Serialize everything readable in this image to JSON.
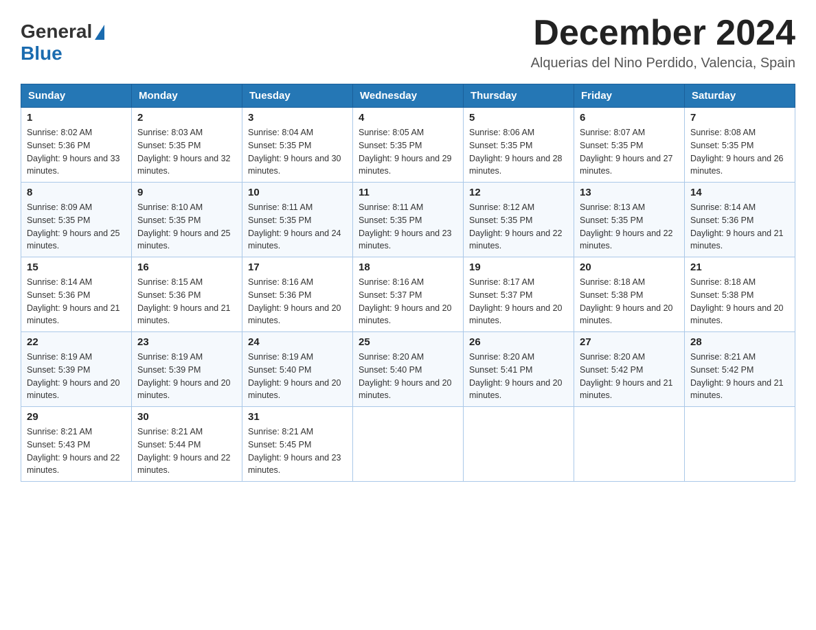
{
  "header": {
    "logo_general": "General",
    "logo_blue": "Blue",
    "month_title": "December 2024",
    "location": "Alquerias del Nino Perdido, Valencia, Spain"
  },
  "weekdays": [
    "Sunday",
    "Monday",
    "Tuesday",
    "Wednesday",
    "Thursday",
    "Friday",
    "Saturday"
  ],
  "weeks": [
    [
      {
        "day": "1",
        "sunrise": "8:02 AM",
        "sunset": "5:36 PM",
        "daylight": "9 hours and 33 minutes."
      },
      {
        "day": "2",
        "sunrise": "8:03 AM",
        "sunset": "5:35 PM",
        "daylight": "9 hours and 32 minutes."
      },
      {
        "day": "3",
        "sunrise": "8:04 AM",
        "sunset": "5:35 PM",
        "daylight": "9 hours and 30 minutes."
      },
      {
        "day": "4",
        "sunrise": "8:05 AM",
        "sunset": "5:35 PM",
        "daylight": "9 hours and 29 minutes."
      },
      {
        "day": "5",
        "sunrise": "8:06 AM",
        "sunset": "5:35 PM",
        "daylight": "9 hours and 28 minutes."
      },
      {
        "day": "6",
        "sunrise": "8:07 AM",
        "sunset": "5:35 PM",
        "daylight": "9 hours and 27 minutes."
      },
      {
        "day": "7",
        "sunrise": "8:08 AM",
        "sunset": "5:35 PM",
        "daylight": "9 hours and 26 minutes."
      }
    ],
    [
      {
        "day": "8",
        "sunrise": "8:09 AM",
        "sunset": "5:35 PM",
        "daylight": "9 hours and 25 minutes."
      },
      {
        "day": "9",
        "sunrise": "8:10 AM",
        "sunset": "5:35 PM",
        "daylight": "9 hours and 25 minutes."
      },
      {
        "day": "10",
        "sunrise": "8:11 AM",
        "sunset": "5:35 PM",
        "daylight": "9 hours and 24 minutes."
      },
      {
        "day": "11",
        "sunrise": "8:11 AM",
        "sunset": "5:35 PM",
        "daylight": "9 hours and 23 minutes."
      },
      {
        "day": "12",
        "sunrise": "8:12 AM",
        "sunset": "5:35 PM",
        "daylight": "9 hours and 22 minutes."
      },
      {
        "day": "13",
        "sunrise": "8:13 AM",
        "sunset": "5:35 PM",
        "daylight": "9 hours and 22 minutes."
      },
      {
        "day": "14",
        "sunrise": "8:14 AM",
        "sunset": "5:36 PM",
        "daylight": "9 hours and 21 minutes."
      }
    ],
    [
      {
        "day": "15",
        "sunrise": "8:14 AM",
        "sunset": "5:36 PM",
        "daylight": "9 hours and 21 minutes."
      },
      {
        "day": "16",
        "sunrise": "8:15 AM",
        "sunset": "5:36 PM",
        "daylight": "9 hours and 21 minutes."
      },
      {
        "day": "17",
        "sunrise": "8:16 AM",
        "sunset": "5:36 PM",
        "daylight": "9 hours and 20 minutes."
      },
      {
        "day": "18",
        "sunrise": "8:16 AM",
        "sunset": "5:37 PM",
        "daylight": "9 hours and 20 minutes."
      },
      {
        "day": "19",
        "sunrise": "8:17 AM",
        "sunset": "5:37 PM",
        "daylight": "9 hours and 20 minutes."
      },
      {
        "day": "20",
        "sunrise": "8:18 AM",
        "sunset": "5:38 PM",
        "daylight": "9 hours and 20 minutes."
      },
      {
        "day": "21",
        "sunrise": "8:18 AM",
        "sunset": "5:38 PM",
        "daylight": "9 hours and 20 minutes."
      }
    ],
    [
      {
        "day": "22",
        "sunrise": "8:19 AM",
        "sunset": "5:39 PM",
        "daylight": "9 hours and 20 minutes."
      },
      {
        "day": "23",
        "sunrise": "8:19 AM",
        "sunset": "5:39 PM",
        "daylight": "9 hours and 20 minutes."
      },
      {
        "day": "24",
        "sunrise": "8:19 AM",
        "sunset": "5:40 PM",
        "daylight": "9 hours and 20 minutes."
      },
      {
        "day": "25",
        "sunrise": "8:20 AM",
        "sunset": "5:40 PM",
        "daylight": "9 hours and 20 minutes."
      },
      {
        "day": "26",
        "sunrise": "8:20 AM",
        "sunset": "5:41 PM",
        "daylight": "9 hours and 20 minutes."
      },
      {
        "day": "27",
        "sunrise": "8:20 AM",
        "sunset": "5:42 PM",
        "daylight": "9 hours and 21 minutes."
      },
      {
        "day": "28",
        "sunrise": "8:21 AM",
        "sunset": "5:42 PM",
        "daylight": "9 hours and 21 minutes."
      }
    ],
    [
      {
        "day": "29",
        "sunrise": "8:21 AM",
        "sunset": "5:43 PM",
        "daylight": "9 hours and 22 minutes."
      },
      {
        "day": "30",
        "sunrise": "8:21 AM",
        "sunset": "5:44 PM",
        "daylight": "9 hours and 22 minutes."
      },
      {
        "day": "31",
        "sunrise": "8:21 AM",
        "sunset": "5:45 PM",
        "daylight": "9 hours and 23 minutes."
      },
      null,
      null,
      null,
      null
    ]
  ]
}
